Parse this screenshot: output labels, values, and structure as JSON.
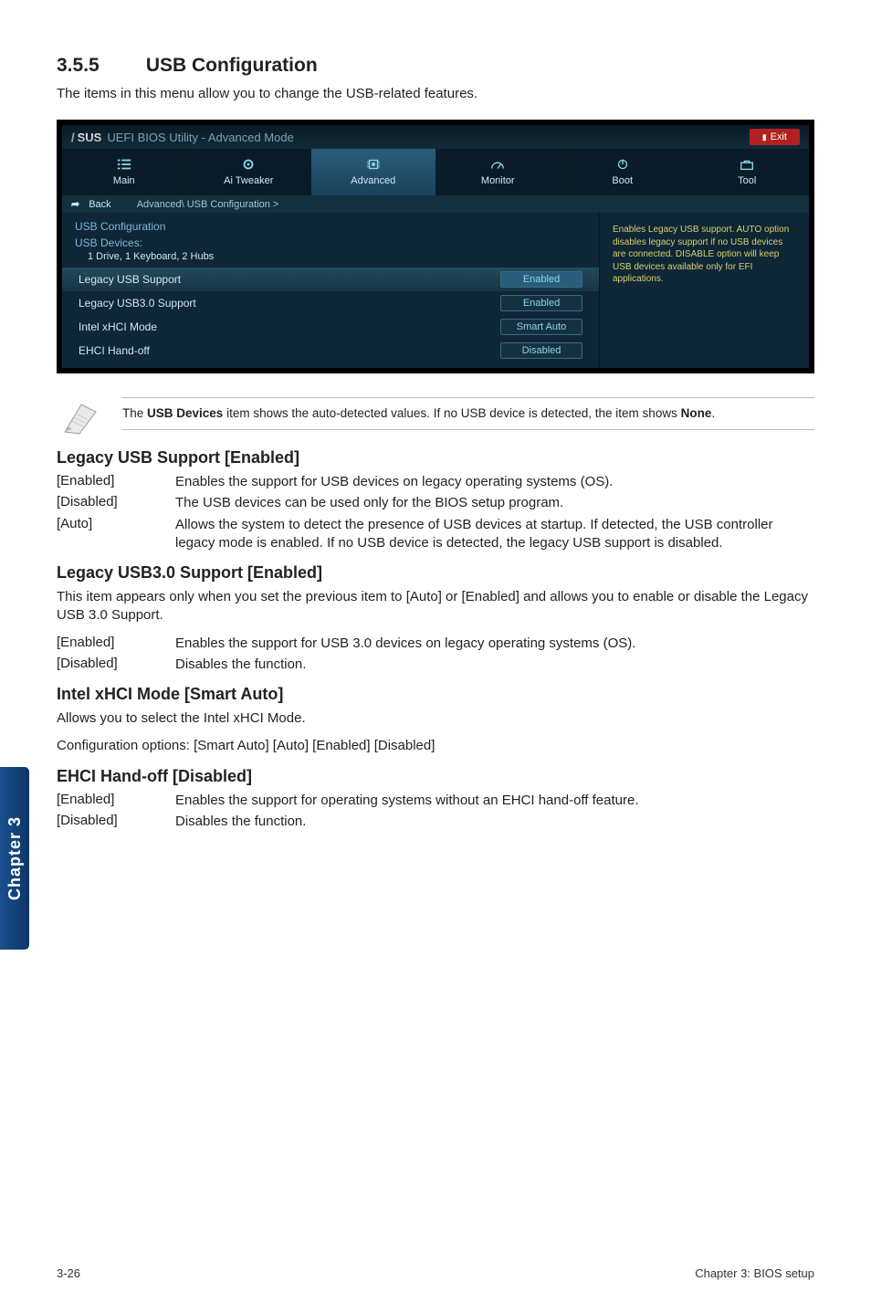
{
  "heading_number": "3.5.5",
  "heading_title": "USB Configuration",
  "intro": "The items in this menu allow you to change the USB-related features.",
  "bios": {
    "title_brand": "SUS",
    "title_rest": "UEFI BIOS Utility - Advanced Mode",
    "exit_label": "Exit",
    "tabs": [
      {
        "label": "Main",
        "icon": "list"
      },
      {
        "label": "Ai Tweaker",
        "icon": "gear"
      },
      {
        "label": "Advanced",
        "icon": "chip"
      },
      {
        "label": "Monitor",
        "icon": "gauge"
      },
      {
        "label": "Boot",
        "icon": "power"
      },
      {
        "label": "Tool",
        "icon": "toolbox"
      }
    ],
    "back_label": "Back",
    "breadcrumb": "Advanced\\ USB Configuration >",
    "section_title": "USB Configuration",
    "devices_label": "USB Devices:",
    "devices_value": "1 Drive, 1 Keyboard, 2 Hubs",
    "rows": [
      {
        "label": "Legacy USB Support",
        "value": "Enabled",
        "hl": true
      },
      {
        "label": "Legacy USB3.0 Support",
        "value": "Enabled",
        "hl": false
      },
      {
        "label": "Intel xHCI Mode",
        "value": "Smart Auto",
        "hl": false
      },
      {
        "label": "EHCI Hand-off",
        "value": "Disabled",
        "hl": false
      }
    ],
    "help": "Enables Legacy USB support. AUTO option disables legacy support if no USB devices are connected. DISABLE option will keep USB devices available only for EFI applications."
  },
  "note_pre": "The ",
  "note_bold": "USB Devices",
  "note_post": " item shows the auto-detected values. If no USB device is detected, the item shows ",
  "note_bold2": "None",
  "note_end": ".",
  "sections": [
    {
      "heading": "Legacy USB Support [Enabled]",
      "defs": [
        {
          "term": "[Enabled]",
          "desc": "Enables the support for USB devices on legacy operating systems (OS)."
        },
        {
          "term": "[Disabled]",
          "desc": "The USB devices can be used only for the BIOS setup program."
        },
        {
          "term": "[Auto]",
          "desc": "Allows the system to detect the presence of USB devices at startup. If detected, the USB controller legacy mode is enabled. If no USB device is detected, the legacy USB support is disabled."
        }
      ]
    },
    {
      "heading": "Legacy USB3.0 Support [Enabled]",
      "para": "This item appears only when you set the previous item to [Auto] or [Enabled] and allows you to enable or disable the Legacy USB 3.0 Support.",
      "defs": [
        {
          "term": "[Enabled]",
          "desc": "Enables the support for USB 3.0 devices on legacy operating systems (OS)."
        },
        {
          "term": "[Disabled]",
          "desc": "Disables the function."
        }
      ]
    },
    {
      "heading": "Intel xHCI Mode [Smart Auto]",
      "para": "Allows you to select the Intel xHCI Mode.\nConfiguration options: [Smart Auto] [Auto] [Enabled] [Disabled]"
    },
    {
      "heading": "EHCI Hand-off [Disabled]",
      "defs": [
        {
          "term": "[Enabled]",
          "desc": "Enables the support for operating systems without an EHCI hand-off feature."
        },
        {
          "term": "[Disabled]",
          "desc": "Disables the function."
        }
      ]
    }
  ],
  "sidetab": "Chapter 3",
  "footer_left": "3-26",
  "footer_right": "Chapter 3: BIOS setup"
}
